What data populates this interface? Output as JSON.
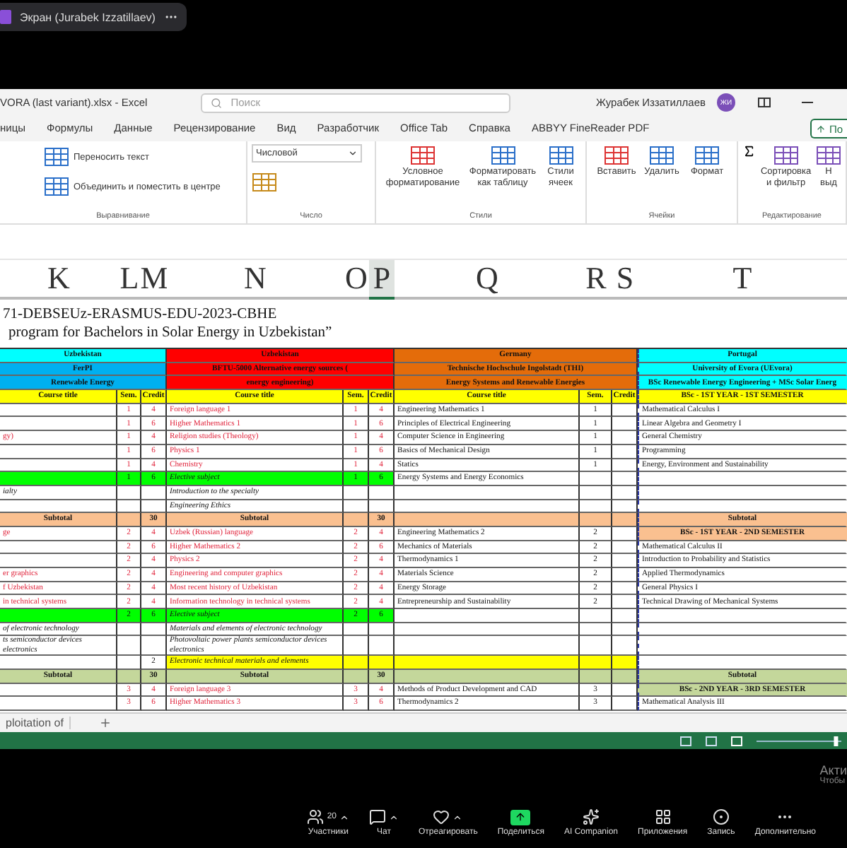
{
  "meeting": {
    "screen_label": "Экран (Jurabek Izzatillaev)",
    "activation_notice": [
      "Акти",
      "Чтобы"
    ],
    "toolbar": [
      {
        "kind": "participants",
        "label": "Участники",
        "count": "20",
        "menu": true
      },
      {
        "kind": "chat",
        "label": "Чат",
        "menu": true
      },
      {
        "kind": "react",
        "label": "Отреагировать",
        "menu": true
      },
      {
        "kind": "share",
        "label": "Поделиться",
        "menu": false
      },
      {
        "kind": "ai",
        "label": "AI Companion",
        "menu": false
      },
      {
        "kind": "apps",
        "label": "Приложения",
        "menu": false
      },
      {
        "kind": "record",
        "label": "Запись",
        "menu": false
      },
      {
        "kind": "more",
        "label": "Дополнительно",
        "menu": false
      }
    ]
  },
  "excel": {
    "title": "VORA (last variant).xlsx  -  Excel",
    "search": {
      "placeholder": "Поиск"
    },
    "user": {
      "name": "Журабек Иззатиллаев",
      "initials": "ЖИ"
    },
    "tabs": [
      {
        "label": "ницы",
        "selected": false
      },
      {
        "label": "Формулы",
        "selected": false
      },
      {
        "label": "Данные",
        "selected": false
      },
      {
        "label": "Рецензирование",
        "selected": false
      },
      {
        "label": "Вид",
        "selected": false
      },
      {
        "label": "Разработчик",
        "selected": false
      },
      {
        "label": "Office Tab",
        "selected": false
      },
      {
        "label": "Справка",
        "selected": false
      },
      {
        "label": "ABBYY FineReader PDF",
        "selected": false
      }
    ],
    "share_button": "По",
    "groups": [
      {
        "kind": "align",
        "name": "Выравнивание",
        "items": [
          "Переносить текст",
          "Объединить и поместить в центре"
        ]
      },
      {
        "kind": "number",
        "name": "Число",
        "items": [
          "Числовой"
        ]
      },
      {
        "kind": "big",
        "name": "Стили",
        "items": [
          "Условное форматирование",
          "Форматировать как таблицу",
          "Стили ячеек"
        ]
      },
      {
        "kind": "big",
        "name": "Ячейки",
        "items": [
          "Вставить",
          "Удалить",
          "Формат"
        ]
      },
      {
        "kind": "edit",
        "name": "Редактирование",
        "items": [
          "Сортировка и фильтр",
          "Н выд"
        ]
      }
    ],
    "columns": [
      {
        "label": "K",
        "selected": false
      },
      {
        "label": "L",
        "selected": false
      },
      {
        "label": "M",
        "selected": false
      },
      {
        "label": "N",
        "selected": false
      },
      {
        "label": "O",
        "selected": false
      },
      {
        "label": "P",
        "selected": true
      },
      {
        "label": "Q",
        "selected": false
      },
      {
        "label": "R",
        "selected": false
      },
      {
        "label": "S",
        "selected": false
      },
      {
        "label": "T",
        "selected": false
      }
    ],
    "title_lines": [
      "71-DEBSEUz-ERASMUS-EDU-2023-CBHE",
      "program for Bachelors in Solar Energy in Uzbekistan”"
    ],
    "rows": [
      {
        "kind": "header",
        "cells": [
          {
            "text": "Uzbekistan",
            "color": "#00ffff"
          },
          {
            "text": "Uzbekistan",
            "color": "#ff0000"
          },
          {
            "text": "Germany",
            "color": "#e46c0a"
          },
          {
            "text": "Portugal",
            "color": "#00ffff"
          }
        ]
      },
      {
        "kind": "header",
        "cells": [
          {
            "text": "FerPI",
            "color": "#00b0f0"
          },
          {
            "text": "BFTU-5000 Alternative energy sources (",
            "color": "#ff0000"
          },
          {
            "text": "Technische Hochschule Ingolstadt (THI)",
            "color": "#e46c0a"
          },
          {
            "text": "University of Evora (UEvora)",
            "color": "#00ffff"
          }
        ]
      },
      {
        "kind": "header",
        "cells": [
          {
            "text": "Renewable Energy",
            "color": "#00b0f0"
          },
          {
            "text": "energy engineering)",
            "color": "#ff0000"
          },
          {
            "text": "Energy Systems and Renewable Energies",
            "color": "#e46c0a"
          },
          {
            "text": "BSc Renewable Energy Engineering + MSc Solar Energ",
            "color": "#00ffff"
          }
        ]
      },
      {
        "kind": "columns",
        "cells": [
          {
            "text": "Course title",
            "color": "#ffff00"
          },
          {
            "text": "Sem.",
            "color": "#ffff00"
          },
          {
            "text": "Credit",
            "color": "#ffff00"
          },
          {
            "text": "Course title",
            "color": "#ffff00"
          },
          {
            "text": "Sem.",
            "color": "#ffff00"
          },
          {
            "text": "Credit",
            "color": "#ffff00"
          },
          {
            "text": "Course title",
            "color": "#ffff00"
          },
          {
            "text": "Sem.",
            "color": "#ffff00"
          },
          {
            "text": "Credit",
            "color": "#ffff00"
          },
          {
            "text": "BSc - 1ST YEAR - 1ST SEMESTER",
            "color": "#ffff00"
          }
        ]
      },
      {
        "kind": "course",
        "cells": [
          {},
          {
            "text": "1"
          },
          {
            "text": "4"
          },
          {
            "text": "Foreign language 1"
          },
          {
            "text": "1"
          },
          {
            "text": "4"
          },
          {
            "text": "Engineering Mathematics 1"
          },
          {
            "text": "1"
          },
          {},
          {
            "text": "Mathematical Calculus I"
          }
        ]
      },
      {
        "kind": "course",
        "cells": [
          {},
          {
            "text": "1"
          },
          {
            "text": "6"
          },
          {
            "text": "Higher Mathematics 1"
          },
          {
            "text": "1"
          },
          {
            "text": "6"
          },
          {
            "text": "Principles of Electrical Engineering"
          },
          {
            "text": "1"
          },
          {},
          {
            "text": "Linear Algebra and Geometry I"
          }
        ]
      },
      {
        "kind": "course",
        "cells": [
          {
            "text": "gy)"
          },
          {
            "text": "1"
          },
          {
            "text": "4"
          },
          {
            "text": "Religion studies (Theology)"
          },
          {
            "text": "1"
          },
          {
            "text": "4"
          },
          {
            "text": "Computer Science in Engineering"
          },
          {
            "text": "1"
          },
          {},
          {
            "text": "General Chemistry"
          }
        ]
      },
      {
        "kind": "course",
        "cells": [
          {},
          {
            "text": "1"
          },
          {
            "text": "6"
          },
          {
            "text": "Physics 1"
          },
          {
            "text": "1"
          },
          {
            "text": "6"
          },
          {
            "text": "Basics of Mechanical Design"
          },
          {
            "text": "1"
          },
          {},
          {
            "text": "Programming"
          }
        ]
      },
      {
        "kind": "course",
        "cells": [
          {},
          {
            "text": "1"
          },
          {
            "text": "4"
          },
          {
            "text": "Chemistry"
          },
          {
            "text": "1"
          },
          {
            "text": "4"
          },
          {
            "text": "Statics"
          },
          {
            "text": "1"
          },
          {},
          {
            "text": "Energy, Environment and Sustainability"
          }
        ]
      },
      {
        "kind": "elective",
        "cells": [
          {
            "color": "#00ff00"
          },
          {
            "text": "1",
            "color": "#00ff00"
          },
          {
            "text": "6",
            "color": "#00ff00"
          },
          {
            "text": "Elective subject",
            "color": "#00ff00"
          },
          {
            "text": "1",
            "color": "#00ff00"
          },
          {
            "text": "6",
            "color": "#00ff00"
          },
          {
            "text": "Energy Systems and Energy Economics"
          },
          {},
          {},
          {}
        ]
      },
      {
        "kind": "note",
        "cells": [
          {
            "text": "ialty"
          },
          {},
          {},
          {
            "text": "Introduction to the specialty"
          },
          {},
          {},
          {},
          {},
          {},
          {}
        ]
      },
      {
        "kind": "note",
        "cells": [
          {},
          {},
          {},
          {
            "text": "Engineering Ethics"
          },
          {},
          {},
          {},
          {},
          {},
          {}
        ]
      },
      {
        "kind": "subtotal",
        "cells": [
          {
            "text": "Subtotal",
            "color": "#fac090"
          },
          {
            "color": "#fac090"
          },
          {
            "text": "30",
            "color": "#fac090"
          },
          {
            "text": "Subtotal",
            "color": "#fac090"
          },
          {
            "color": "#fac090"
          },
          {
            "text": "30",
            "color": "#fac090"
          },
          {
            "color": "#fac090"
          },
          {
            "color": "#fac090"
          },
          {
            "color": "#fac090"
          },
          {
            "text": "Subtotal",
            "color": "#fac090"
          }
        ]
      },
      {
        "kind": "course",
        "cells": [
          {
            "text": "ge"
          },
          {
            "text": "2"
          },
          {
            "text": "4"
          },
          {
            "text": "Uzbek (Russian) language"
          },
          {
            "text": "2"
          },
          {
            "text": "4"
          },
          {
            "text": "Engineering Mathematics 2"
          },
          {
            "text": "2"
          },
          {},
          {
            "text": "BSc - 1ST YEAR - 2ND SEMESTER",
            "color": "#fac090",
            "kind": "heading"
          }
        ]
      },
      {
        "kind": "course",
        "cells": [
          {},
          {
            "text": "2"
          },
          {
            "text": "6"
          },
          {
            "text": "Higher Mathematics 2"
          },
          {
            "text": "2"
          },
          {
            "text": "6"
          },
          {
            "text": "Mechanics of Materials"
          },
          {
            "text": "2"
          },
          {},
          {
            "text": "Mathematical Calculus II"
          }
        ]
      },
      {
        "kind": "course",
        "cells": [
          {},
          {
            "text": "2"
          },
          {
            "text": "4"
          },
          {
            "text": "Physics 2"
          },
          {
            "text": "2"
          },
          {
            "text": "4"
          },
          {
            "text": "Thermodynamics 1"
          },
          {
            "text": "2"
          },
          {},
          {
            "text": "Introduction to Probability and Statistics"
          }
        ]
      },
      {
        "kind": "course",
        "cells": [
          {
            "text": "er graphics"
          },
          {
            "text": "2"
          },
          {
            "text": "4"
          },
          {
            "text": "Engineering and computer graphics"
          },
          {
            "text": "2"
          },
          {
            "text": "4"
          },
          {
            "text": "Materials Science"
          },
          {
            "text": "2"
          },
          {},
          {
            "text": "Applied Thermodynamics"
          }
        ]
      },
      {
        "kind": "course",
        "cells": [
          {
            "text": "f Uzbekistan"
          },
          {
            "text": "2"
          },
          {
            "text": "4"
          },
          {
            "text": "Most recent history of Uzbekistan"
          },
          {
            "text": "2"
          },
          {
            "text": "4"
          },
          {
            "text": "Energy Storage"
          },
          {
            "text": "2"
          },
          {},
          {
            "text": "General Physics I"
          }
        ]
      },
      {
        "kind": "course",
        "cells": [
          {
            "text": "in technical systems"
          },
          {
            "text": "2"
          },
          {
            "text": "4"
          },
          {
            "text": "Information technology in technical systems"
          },
          {
            "text": "2"
          },
          {
            "text": "4"
          },
          {
            "text": "Entrepreneurship and Sustainability"
          },
          {
            "text": "2"
          },
          {},
          {
            "text": "Technical Drawing of Mechanical Systems"
          }
        ]
      },
      {
        "kind": "elective",
        "cells": [
          {
            "color": "#00ff00"
          },
          {
            "text": "2",
            "color": "#00ff00"
          },
          {
            "text": "6",
            "color": "#00ff00"
          },
          {
            "text": "Elective subject",
            "color": "#00ff00"
          },
          {
            "text": "2",
            "color": "#00ff00"
          },
          {
            "text": "6",
            "color": "#00ff00"
          },
          {},
          {},
          {},
          {}
        ]
      },
      {
        "kind": "note",
        "cells": [
          {
            "text": "of electronic technology"
          },
          {},
          {},
          {
            "text": "Materials and elements of electronic technology"
          },
          {},
          {},
          {},
          {},
          {},
          {}
        ]
      },
      {
        "kind": "note",
        "cells": [
          {
            "text": "ts semiconductor devices electronics"
          },
          {},
          {},
          {
            "text": "Photovoltaic power plants semiconductor devices electronics"
          },
          {},
          {},
          {},
          {},
          {},
          {}
        ]
      },
      {
        "kind": "note",
        "cells": [
          {},
          {},
          {
            "text": "2"
          },
          {
            "text": "Electronic technical materials and elements",
            "color": "#ffff00"
          },
          {
            "color": "#ffff00"
          },
          {
            "color": "#ffff00"
          },
          {
            "color": "#ffff00"
          },
          {
            "color": "#ffff00"
          },
          {
            "color": "#ffff00"
          },
          {}
        ]
      },
      {
        "kind": "subtotal",
        "cells": [
          {
            "text": "Subtotal",
            "color": "#c4d79b"
          },
          {
            "color": "#c4d79b"
          },
          {
            "text": "30",
            "color": "#c4d79b"
          },
          {
            "text": "Subtotal",
            "color": "#c4d79b"
          },
          {
            "color": "#c4d79b"
          },
          {
            "text": "30",
            "color": "#c4d79b"
          },
          {
            "color": "#c4d79b"
          },
          {
            "color": "#c4d79b"
          },
          {
            "color": "#c4d79b"
          },
          {
            "text": "Subtotal",
            "color": "#c4d79b"
          }
        ]
      },
      {
        "kind": "course",
        "cells": [
          {},
          {
            "text": "3"
          },
          {
            "text": "4"
          },
          {
            "text": "Foreign language 3"
          },
          {
            "text": "3"
          },
          {
            "text": "4"
          },
          {
            "text": "Methods of Product Development and CAD"
          },
          {
            "text": "3"
          },
          {},
          {
            "text": "BSc - 2ND YEAR - 3RD SEMESTER",
            "color": "#c4d79b",
            "kind": "heading"
          }
        ]
      },
      {
        "kind": "course",
        "cells": [
          {},
          {
            "text": "3"
          },
          {
            "text": "6"
          },
          {
            "text": "Higher Mathematics 3"
          },
          {
            "text": "3"
          },
          {
            "text": "6"
          },
          {
            "text": "Thermodynamics 2"
          },
          {
            "text": "3"
          },
          {},
          {
            "text": "Mathematical Analysis III"
          }
        ]
      }
    ],
    "sheet_tabs": [
      {
        "label": "ploitation of",
        "selected": false
      }
    ],
    "zoom": {
      "level": 0.96
    }
  }
}
